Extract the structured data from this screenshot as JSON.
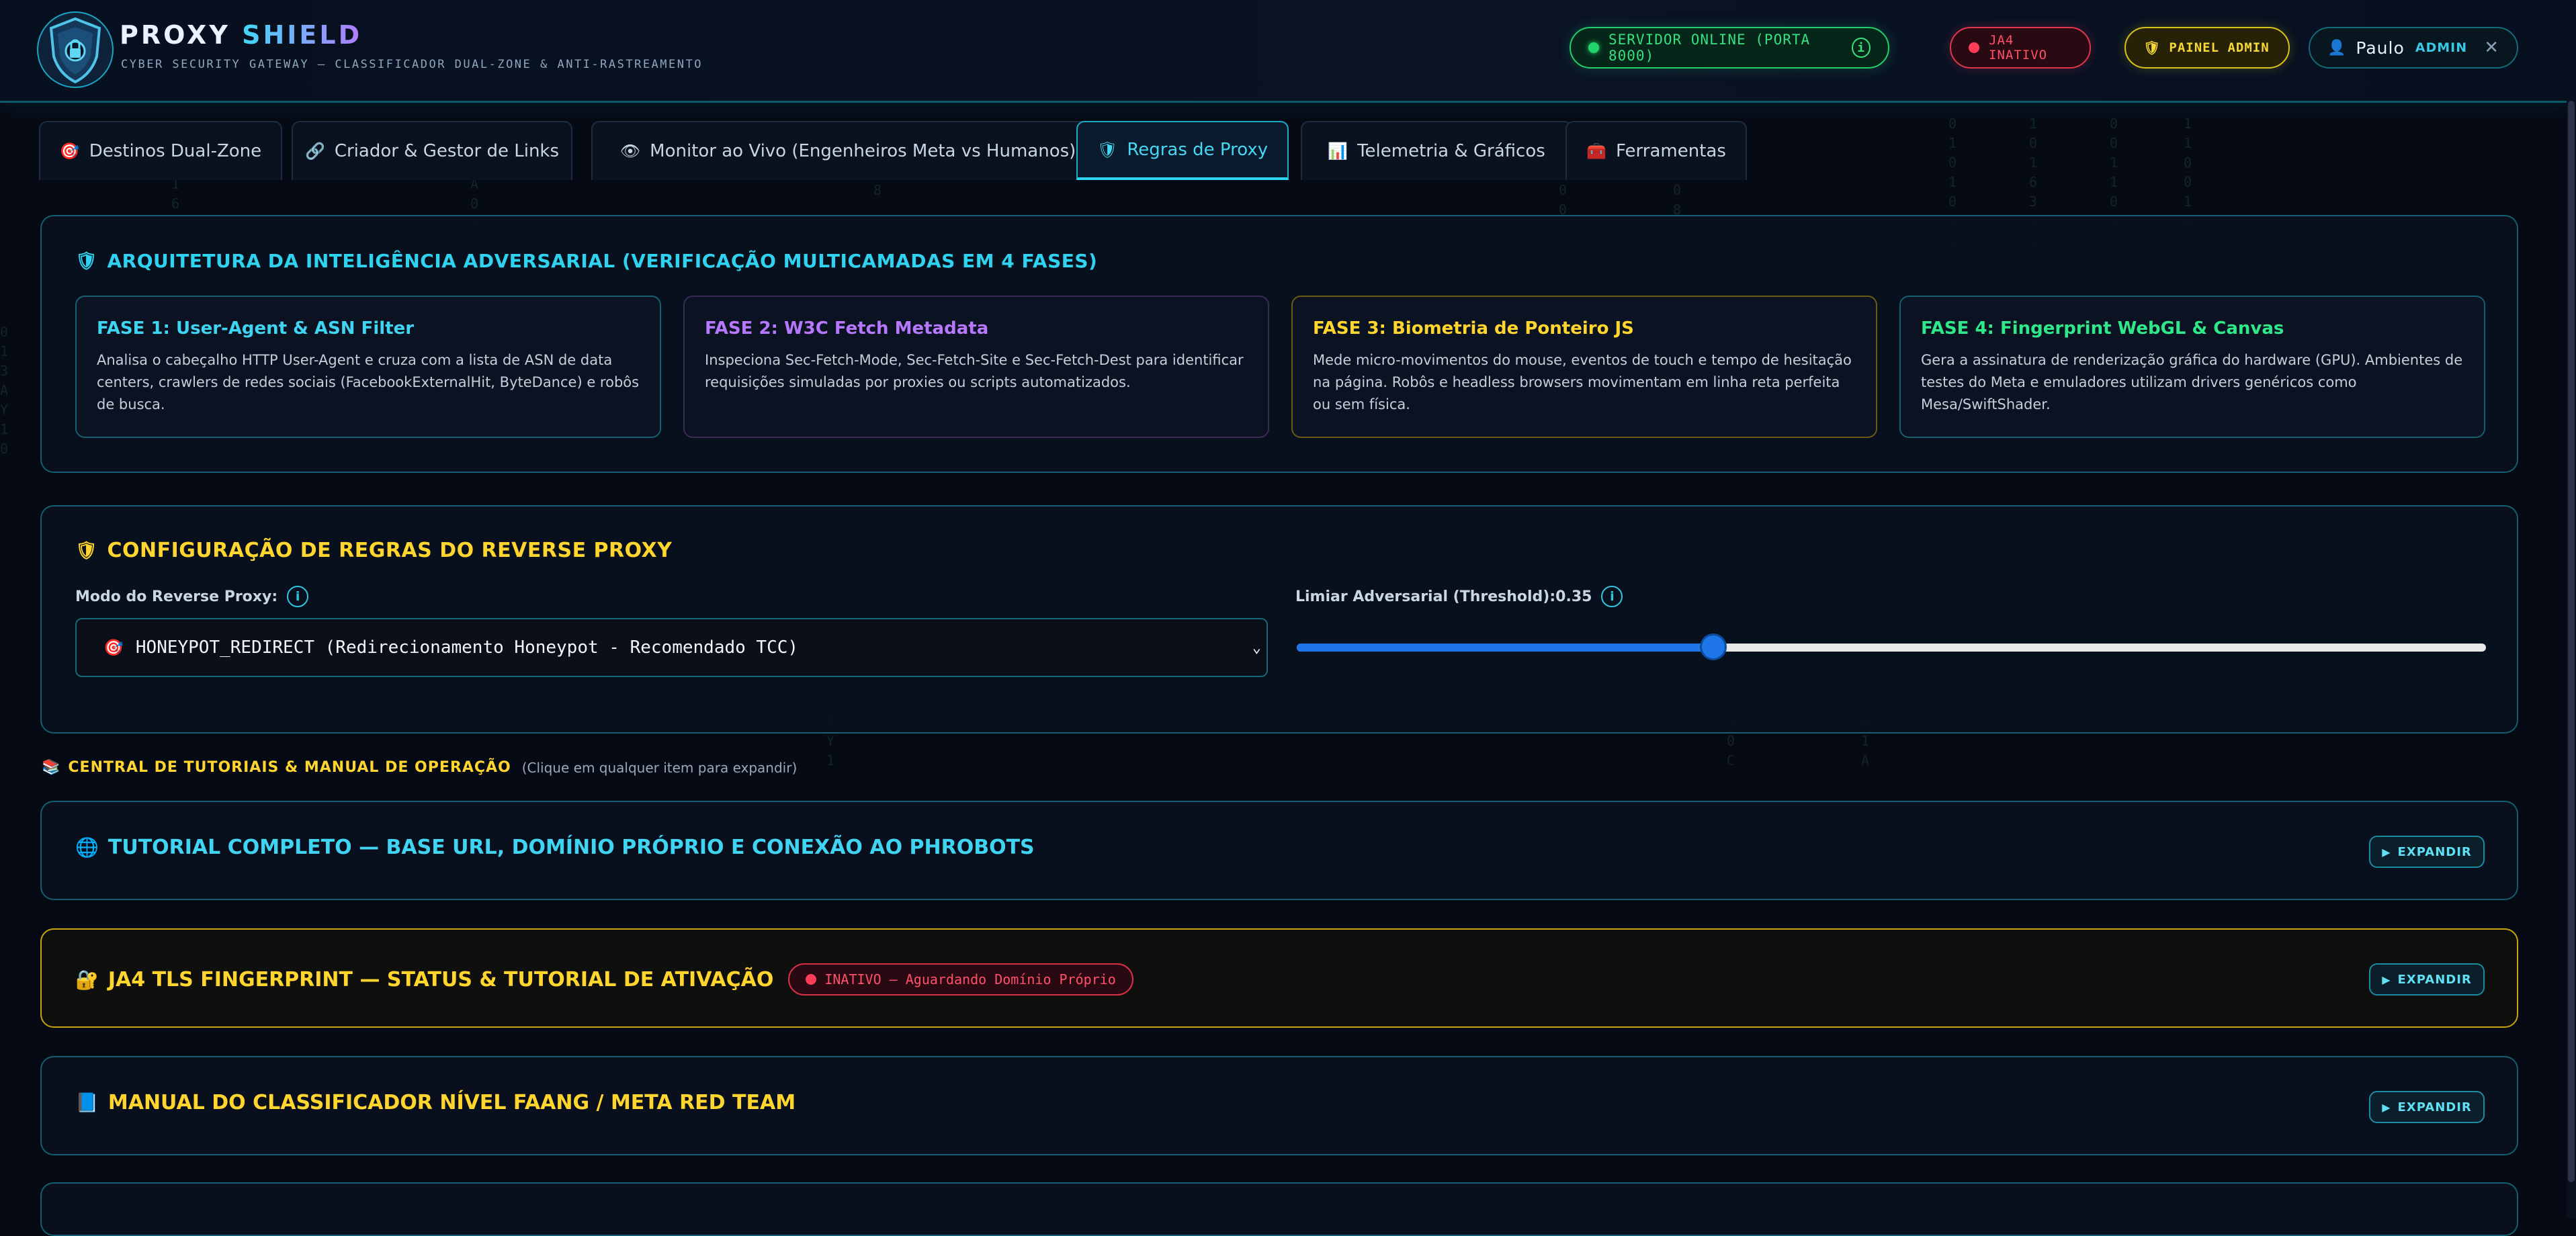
{
  "header": {
    "brand_word1": "PROXY",
    "brand_word2": "SHIELD",
    "tagline": "CYBER SECURITY GATEWAY — CLASSIFICADOR DUAL-ZONE & ANTI-RASTREAMENTO",
    "server_status": "SERVIDOR ONLINE (PORTA 8000)",
    "ja4_status": "JA4 INATIVO",
    "admin_panel": "PAINEL ADMIN",
    "user_name": "Paulo",
    "user_role": "ADMIN",
    "icons": {
      "logo": "shield-logo-icon",
      "info": "info-icon",
      "close": "close-icon",
      "user": "user-icon"
    }
  },
  "tabs": [
    {
      "label": "Destinos Dual-Zone",
      "icon": "target-icon",
      "active": false
    },
    {
      "label": "Criador & Gestor de Links",
      "icon": "link-icon",
      "active": false
    },
    {
      "label": "Monitor ao Vivo (Engenheiros Meta vs Humanos)",
      "icon": "eye-icon",
      "active": false
    },
    {
      "label": "Regras de Proxy",
      "icon": "shield-icon",
      "active": true
    },
    {
      "label": "Telemetria & Gráficos",
      "icon": "chart-icon",
      "active": false
    },
    {
      "label": "Ferramentas",
      "icon": "toolbox-icon",
      "active": false
    }
  ],
  "architecture": {
    "title": "ARQUITETURA DA INTELIGÊNCIA ADVERSARIAL (VERIFICAÇÃO MULTICAMADAS EM 4 FASES)",
    "phases": [
      {
        "title": "FASE 1: User-Agent & ASN Filter",
        "desc": "Analisa o cabeçalho HTTP User-Agent e cruza com a lista de ASN de data centers, crawlers de redes sociais (FacebookExternalHit, ByteDance) e robôs de busca.",
        "color": "#3fd4f2"
      },
      {
        "title": "FASE 2: W3C Fetch Metadata",
        "desc": "Inspeciona Sec-Fetch-Mode, Sec-Fetch-Site e Sec-Fetch-Dest para identificar requisições simuladas por proxies ou scripts automatizados.",
        "color": "#b778ff"
      },
      {
        "title": "FASE 3: Biometria de Ponteiro JS",
        "desc": "Mede micro-movimentos do mouse, eventos de touch e tempo de hesitação na página. Robôs e headless browsers movimentam em linha reta perfeita ou sem física.",
        "color": "#ffd52e"
      },
      {
        "title": "FASE 4: Fingerprint WebGL & Canvas",
        "desc": "Gera a assinatura de renderização gráfica do hardware (GPU). Ambientes de testes do Meta e emuladores utilizam drivers genéricos como Mesa/SwiftShader.",
        "color": "#2ee88a"
      }
    ]
  },
  "proxy_rules": {
    "title": "CONFIGURAÇÃO DE REGRAS DO REVERSE PROXY",
    "mode_label": "Modo do Reverse Proxy:",
    "mode_value": "HONEYPOT_REDIRECT (Redirecionamento Honeypot - Recomendado TCC)",
    "threshold_label": "Limiar Adversarial (Threshold):",
    "threshold_value": "0.35",
    "threshold_fraction": 0.35
  },
  "tutorials": {
    "title": "CENTRAL DE TUTORIAIS & MANUAL DE OPERAÇÃO",
    "hint": "(Clique em qualquer item para expandir)",
    "expand_label": "EXPANDIR",
    "items": [
      {
        "title": "TUTORIAL COMPLETO — BASE URL, DOMÍNIO PRÓPRIO E CONEXÃO AO PHROBOTS",
        "icon": "globe-icon",
        "color": "#3fd4f2"
      },
      {
        "title": "JA4 TLS FINGERPRINT — STATUS & TUTORIAL DE ATIVAÇÃO",
        "icon": "lock-icon",
        "color": "#ffd52e",
        "badge": "INATIVO — Aguardando Domínio Próprio"
      },
      {
        "title": "MANUAL DO CLASSIFICADOR NÍVEL FAANG / META RED TEAM",
        "icon": "book-icon",
        "color": "#ffd52e"
      }
    ]
  }
}
